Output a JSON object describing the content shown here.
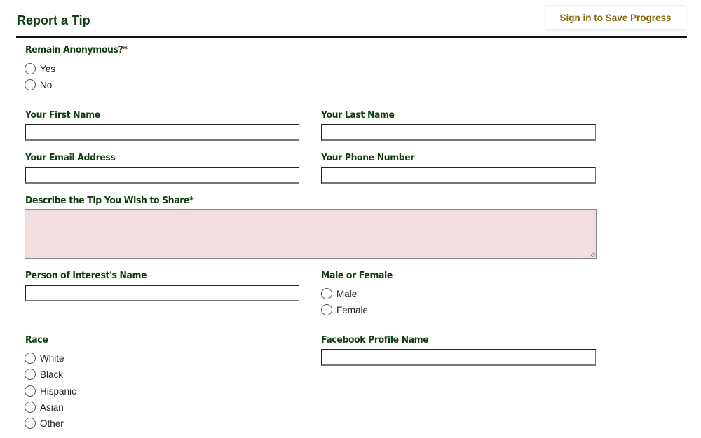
{
  "header": {
    "title": "Report a Tip",
    "signin_label": "Sign in to Save Progress"
  },
  "colors": {
    "label_green": "#103c12",
    "signin_gold": "#8a6a10",
    "required_field_bg": "#f1dfdf"
  },
  "form": {
    "anonymous": {
      "label": "Remain Anonymous?*",
      "options": [
        "Yes",
        "No"
      ],
      "selected": null
    },
    "first_name": {
      "label": "Your First Name",
      "value": ""
    },
    "last_name": {
      "label": "Your Last Name",
      "value": ""
    },
    "email": {
      "label": "Your Email Address",
      "value": ""
    },
    "phone": {
      "label": "Your Phone Number",
      "value": ""
    },
    "tip": {
      "label": "Describe the Tip You Wish to Share*",
      "value": ""
    },
    "poi_name": {
      "label": "Person of Interest's Name",
      "value": ""
    },
    "gender": {
      "label": "Male or Female",
      "options": [
        "Male",
        "Female"
      ],
      "selected": null
    },
    "race": {
      "label": "Race",
      "options": [
        "White",
        "Black",
        "Hispanic",
        "Asian",
        "Other"
      ],
      "selected": null
    },
    "facebook": {
      "label": "Facebook Profile Name",
      "value": ""
    }
  }
}
